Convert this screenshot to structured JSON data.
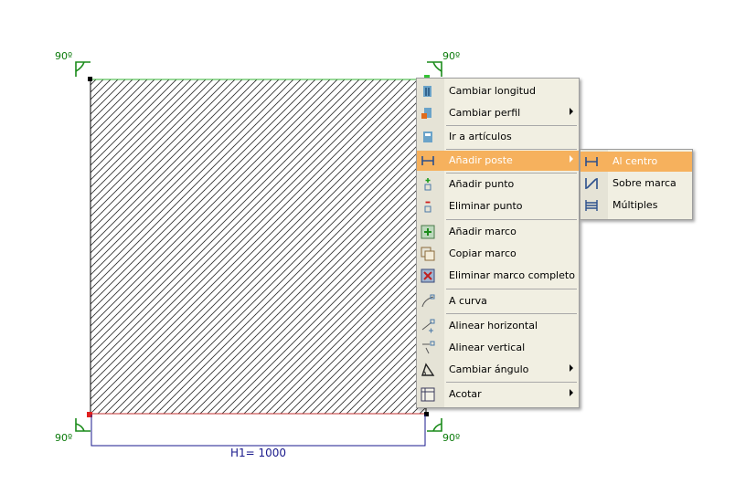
{
  "canvas": {
    "angles": [
      "90º",
      "90º",
      "90º",
      "90º"
    ],
    "dimension_label": "H1= 1000"
  },
  "context_menu": {
    "items": [
      {
        "label": "Cambiar longitud",
        "icon": "change-length-icon",
        "submenu": false
      },
      {
        "label": "Cambiar perfil",
        "icon": "change-profile-icon",
        "submenu": true
      },
      {
        "label": "Ir a artículos",
        "icon": "go-to-articles-icon",
        "submenu": false
      },
      {
        "label": "Añadir poste",
        "icon": "add-post-icon",
        "submenu": true,
        "highlighted": true
      },
      {
        "label": "Añadir punto",
        "icon": "add-point-icon",
        "submenu": false
      },
      {
        "label": "Eliminar punto",
        "icon": "remove-point-icon",
        "submenu": false
      },
      {
        "label": "Añadir marco",
        "icon": "add-frame-icon",
        "submenu": false
      },
      {
        "label": "Copiar marco",
        "icon": "copy-frame-icon",
        "submenu": false
      },
      {
        "label": "Eliminar marco completo",
        "icon": "delete-frame-icon",
        "submenu": false
      },
      {
        "label": "A curva",
        "icon": "curve-icon",
        "submenu": false
      },
      {
        "label": "Alinear horizontal",
        "icon": "align-horizontal-icon",
        "submenu": false
      },
      {
        "label": "Alinear vertical",
        "icon": "align-vertical-icon",
        "submenu": false
      },
      {
        "label": "Cambiar ángulo",
        "icon": "change-angle-icon",
        "submenu": true
      },
      {
        "label": "Acotar",
        "icon": "dimension-icon",
        "submenu": true
      }
    ]
  },
  "submenu": {
    "items": [
      {
        "label": "Al centro",
        "icon": "post-center-icon",
        "highlighted": true
      },
      {
        "label": "Sobre marca",
        "icon": "post-on-mark-icon"
      },
      {
        "label": "Múltiples",
        "icon": "post-multiple-icon"
      }
    ]
  },
  "colors": {
    "highlight": "#f6b15d",
    "menu_bg": "#f1efe2",
    "angle_green": "#0a7a0a",
    "dimension_blue": "#1a1a8c"
  }
}
